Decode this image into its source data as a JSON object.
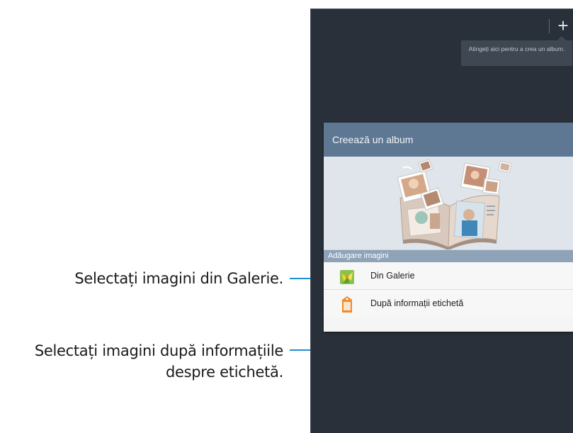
{
  "annotations": {
    "gallery_callout": "Selectați imagini din Galerie.",
    "tag_callout_line1": "Selectați imagini după informațiile",
    "tag_callout_line2": "despre etichetă."
  },
  "action_bar": {
    "add_icon": "plus-icon",
    "add_glyph": "+",
    "tooltip": "Atingeți aici pentru a crea un album."
  },
  "dialog": {
    "title": "Creează un album",
    "section_header": "Adăugare imagini",
    "options": [
      {
        "label": "Din Galerie",
        "icon": "gallery-icon"
      },
      {
        "label": "După informații etichetă",
        "icon": "tag-icon"
      }
    ]
  },
  "colors": {
    "callout_line": "#1b8fd1",
    "screen_background": "#293039",
    "dialog_title_bar": "#5e7893",
    "section_header": "#8ea3b7"
  }
}
